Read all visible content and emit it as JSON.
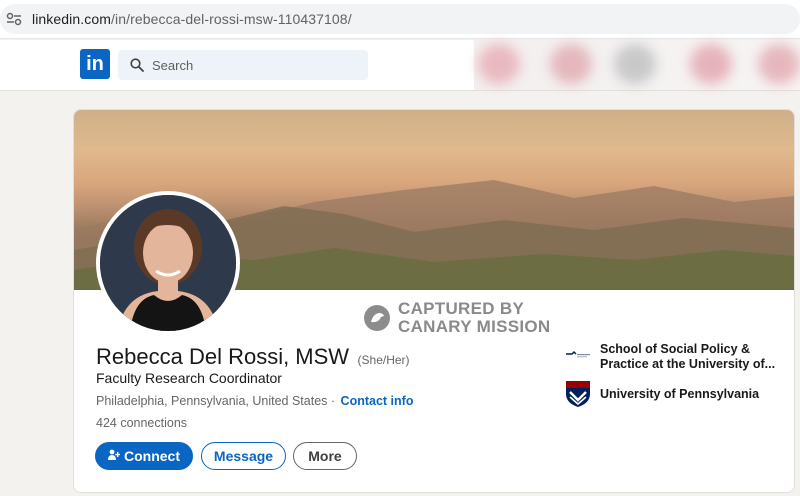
{
  "browser": {
    "url_host": "linkedin.com",
    "url_path": "/in/rebecca-del-rossi-msw-110437108/"
  },
  "nav": {
    "logo_text": "in",
    "search_placeholder": "Search"
  },
  "watermark": {
    "line1": "CAPTURED BY",
    "line2": "CANARY MISSION"
  },
  "profile": {
    "name": "Rebecca Del Rossi, MSW",
    "pronouns": "(She/Her)",
    "headline": "Faculty Research Coordinator",
    "location": "Philadelphia, Pennsylvania, United States",
    "separator": "·",
    "contact_info": "Contact info",
    "connections": "424 connections"
  },
  "actions": {
    "connect": "Connect",
    "message": "Message",
    "more": "More"
  },
  "education": [
    {
      "name": "School of Social Policy & Practice at the University of..."
    },
    {
      "name": "University of Pennsylvania"
    }
  ],
  "colors": {
    "linkedin_blue": "#0a66c2",
    "penn_red": "#990000",
    "penn_blue": "#011f5b"
  }
}
